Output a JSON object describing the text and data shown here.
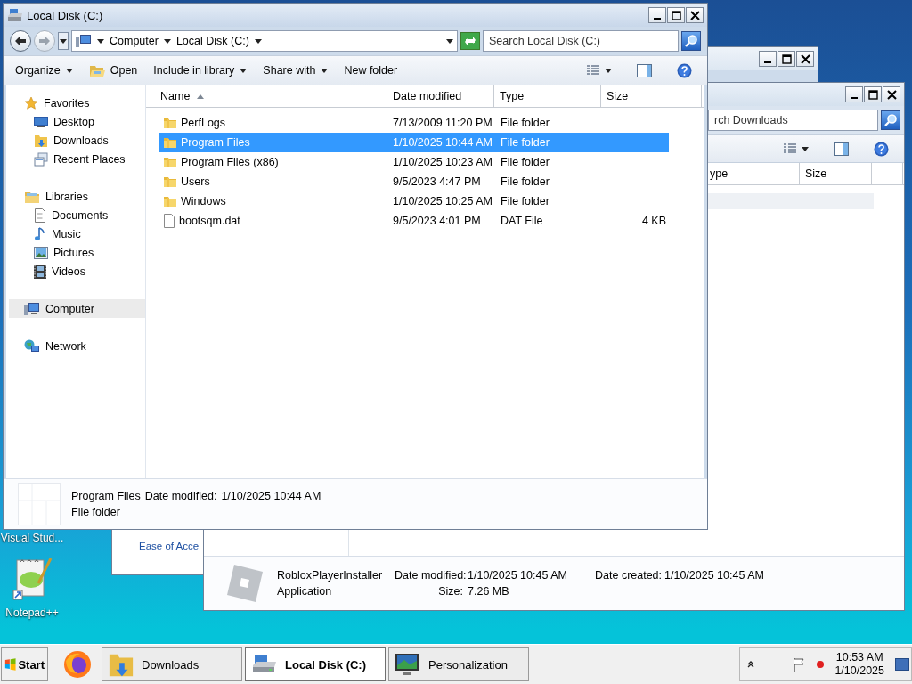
{
  "desktop_icons": [
    {
      "label": "Visual Stud..."
    },
    {
      "label": "Notepad++"
    }
  ],
  "personalization_window": {
    "link": "Ease of Acce"
  },
  "downloads_window": {
    "search": {
      "placeholder": "rch Downloads"
    },
    "columns": [
      "ype",
      "Size"
    ],
    "details": {
      "lines": [
        {
          "title": "RobloxPlayerInstaller",
          "fields": [
            {
              "label": "Date modified:",
              "value": "1/10/2025 10:45 AM"
            },
            {
              "label": "Date created:",
              "value": "1/10/2025 10:45 AM"
            }
          ]
        },
        {
          "title": "Application",
          "fields": [
            {
              "label": "Size:",
              "value": "7.26 MB"
            }
          ]
        }
      ]
    }
  },
  "main_window": {
    "title": "Local Disk (C:)",
    "breadcrumb": [
      "Computer",
      "Local Disk (C:)"
    ],
    "search": {
      "placeholder": "Search Local Disk (C:)"
    },
    "toolbar": [
      {
        "label": "Organize",
        "kind": "menu"
      },
      {
        "label": "Open",
        "kind": "open"
      },
      {
        "label": "Include in library",
        "kind": "menu"
      },
      {
        "label": "Share with",
        "kind": "menu"
      },
      {
        "label": "New folder",
        "kind": "button"
      }
    ],
    "nav": [
      {
        "label": "Favorites",
        "kind": "favorites",
        "selected": false,
        "children": [
          {
            "label": "Desktop",
            "kind": "desktop",
            "selected": false
          },
          {
            "label": "Downloads",
            "kind": "downloads",
            "selected": false
          },
          {
            "label": "Recent Places",
            "kind": "recent",
            "selected": false
          }
        ]
      },
      {
        "label": "Libraries",
        "kind": "libraries",
        "selected": false,
        "children": [
          {
            "label": "Documents",
            "kind": "documents",
            "selected": false
          },
          {
            "label": "Music",
            "kind": "music",
            "selected": false
          },
          {
            "label": "Pictures",
            "kind": "pictures",
            "selected": false
          },
          {
            "label": "Videos",
            "kind": "videos",
            "selected": false
          }
        ]
      },
      {
        "label": "Computer",
        "kind": "computer",
        "selected": true
      },
      {
        "label": "Network",
        "kind": "network",
        "selected": false
      }
    ],
    "columns": [
      {
        "label": "Name",
        "sorted": true
      },
      {
        "label": "Date modified",
        "sorted": false
      },
      {
        "label": "Type",
        "sorted": false
      },
      {
        "label": "Size",
        "sorted": false
      }
    ],
    "rows": [
      {
        "name": "PerfLogs",
        "kind": "folder",
        "date": "7/13/2009 11:20 PM",
        "type": "File folder",
        "selected": false
      },
      {
        "name": "Program Files",
        "kind": "folder",
        "date": "1/10/2025 10:44 AM",
        "type": "File folder",
        "selected": true
      },
      {
        "name": "Program Files (x86)",
        "kind": "folder",
        "date": "1/10/2025 10:23 AM",
        "type": "File folder",
        "selected": false
      },
      {
        "name": "Users",
        "kind": "folder",
        "date": "9/5/2023 4:47 PM",
        "type": "File folder",
        "selected": false
      },
      {
        "name": "Windows",
        "kind": "folder",
        "date": "1/10/2025 10:25 AM",
        "type": "File folder",
        "selected": false
      },
      {
        "name": "bootsqm.dat",
        "kind": "file",
        "date": "9/5/2023 4:01 PM",
        "type": "DAT File",
        "size": "4 KB",
        "selected": false
      }
    ],
    "details": {
      "lines": [
        {
          "title": "Program Files",
          "fields": [
            {
              "label": "Date modified:",
              "value": "1/10/2025 10:44 AM"
            }
          ]
        },
        {
          "title": "File folder"
        }
      ]
    }
  },
  "taskbar": {
    "start": "Start",
    "buttons": [
      {
        "label": "Downloads",
        "kind": "downloads",
        "selected": false
      },
      {
        "label": "Local Disk (C:)",
        "kind": "drive",
        "selected": true
      },
      {
        "label": "Personalization",
        "kind": "personalization",
        "selected": false
      }
    ],
    "time": "10:53 AM",
    "date": "1/10/2025"
  }
}
